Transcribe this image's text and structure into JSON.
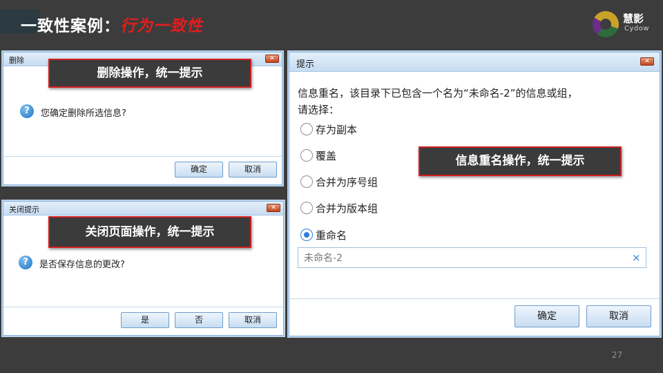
{
  "header": {
    "title_prefix": "一致性案例：",
    "title_highlight": "行为一致性",
    "logo_cn": "慧影",
    "logo_en": "Cydow"
  },
  "page_number": "27",
  "delete_dialog": {
    "title": "删除",
    "close_glyph": "✕",
    "message": "您确定删除所选信息?",
    "question_glyph": "?",
    "ok_label": "确定",
    "cancel_label": "取消"
  },
  "close_dialog": {
    "title": "关闭提示",
    "close_glyph": "✕",
    "message": "是否保存信息的更改?",
    "question_glyph": "?",
    "yes_label": "是",
    "no_label": "否",
    "cancel_label": "取消"
  },
  "rename_dialog": {
    "title": "提示",
    "close_glyph": "✕",
    "message_line1": "信息重名，该目录下已包含一个名为“未命名-2”的信息或组，",
    "message_line2": "请选择：",
    "options": [
      {
        "label": "存为副本",
        "checked": false
      },
      {
        "label": "覆盖",
        "checked": false
      },
      {
        "label": "合并为序号组",
        "checked": false
      },
      {
        "label": "合并为版本组",
        "checked": false
      },
      {
        "label": "重命名",
        "checked": true
      }
    ],
    "rename_value": "未命名-2",
    "clear_glyph": "×",
    "ok_label": "确定",
    "cancel_label": "取消"
  },
  "callouts": {
    "delete": "删除操作，统一提示",
    "close": "关闭页面操作，统一提示",
    "rename": "信息重名操作，统一提示"
  },
  "colors": {
    "background": "#3c3c3c",
    "title_highlight": "#e11d1d",
    "callout_border": "#d11f1f",
    "dialog_titlebar": "#c8dcf1",
    "radio_checked": "#2f7ed8"
  },
  "icons": {
    "question": "question-circle-icon",
    "close": "close-icon",
    "clear": "clear-icon"
  }
}
